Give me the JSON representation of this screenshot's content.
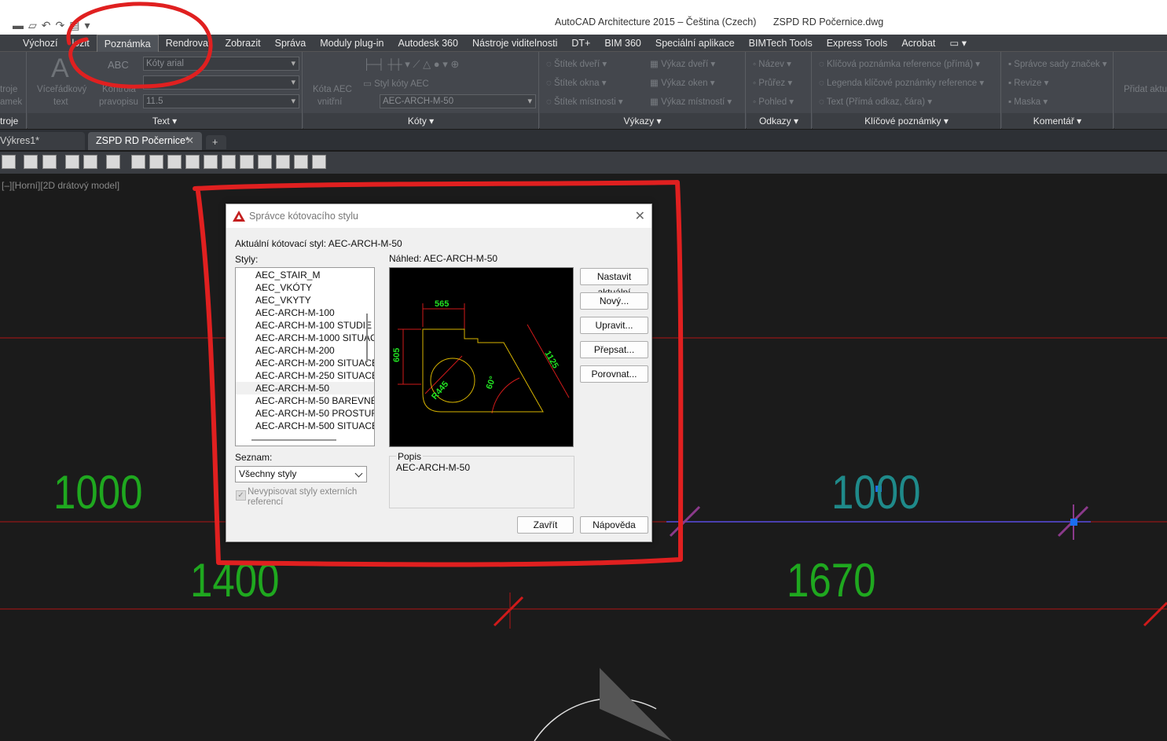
{
  "titlebar": {
    "app_title": "AutoCAD Architecture 2015 – Čeština (Czech)",
    "file_name": "ZSPD RD Počernice.dwg"
  },
  "ribbon_tabs": [
    "Výchozí",
    "ložit",
    "Poznámka",
    "Rendrovat",
    "Zobrazit",
    "Správa",
    "Moduly plug-in",
    "Autodesk 360",
    "Nástroje viditelnosti",
    "DT+",
    "BIM 360",
    "Speciální aplikace",
    "BIMTech Tools",
    "Express Tools",
    "Acrobat"
  ],
  "active_tab": "Poznámka",
  "ribbon": {
    "left_partial_1": "troje",
    "left_partial_2": "amek",
    "left_panel_label": "troje",
    "text_panel": {
      "mtext_label_1": "Víceřádkový",
      "mtext_label_2": "text",
      "spell_label_1": "Kontrola",
      "spell_label_2": "pravopisu",
      "abc": "ABC",
      "style_value": "Kóty arial",
      "height_value": "11.5",
      "label": "Text"
    },
    "dims_panel": {
      "aec_dim_label_1": "Kóta AEC",
      "aec_dim_label_2": "vnitřní",
      "aec_style_label": "Styl kóty AEC",
      "dim_style_value": "AEC-ARCH-M-50",
      "label": "Kóty"
    },
    "reports_panel": {
      "items_left": [
        "Štítek dveří",
        "Štítek okna",
        "Štítek místnosti"
      ],
      "items_right": [
        "Výkaz dveří",
        "Výkaz oken",
        "Výkaz místností"
      ],
      "label": "Výkazy"
    },
    "refs_panel": {
      "items": [
        "Název",
        "Průřez",
        "Pohled"
      ],
      "label": "Odkazy"
    },
    "keynotes_panel": {
      "items": [
        "Klíčová poznámka reference (přímá)",
        "Legenda klíčové poznámky reference",
        "Text (Přímá odkaz, čára)"
      ],
      "label": "Klíčové poznámky"
    },
    "comment_panel": {
      "items": [
        "Správce sady značek",
        "Revize",
        "Maska"
      ],
      "label": "Komentář"
    },
    "right_partial": "Přidat aktu"
  },
  "doc_tabs": [
    {
      "label": "Výkres1*"
    },
    {
      "label": "ZSPD RD Počernice*"
    }
  ],
  "viewport_label": "[–][Horní][2D drátový model]",
  "canvas_dims": [
    "1000",
    "1000",
    "1400",
    "1670"
  ],
  "dialog": {
    "title": "Správce kótovacího stylu",
    "current_style_label": "Aktuální kótovací styl: AEC-ARCH-M-50",
    "styles_label": "Styly:",
    "preview_label": "Náhled: AEC-ARCH-M-50",
    "styles": [
      "AEC_STAIR_M",
      "AEC_VKÓTY",
      "AEC_VKYTY",
      "AEC-ARCH-M-100",
      "AEC-ARCH-M-100 STUDIE",
      "AEC-ARCH-M-1000 SITUAC",
      "AEC-ARCH-M-200",
      "AEC-ARCH-M-200 SITUACE",
      "AEC-ARCH-M-250 SITUACE",
      "AEC-ARCH-M-50",
      "AEC-ARCH-M-50 BAREVNÉ",
      "AEC-ARCH-M-50 PROSTUF",
      "AEC-ARCH-M-500 SITUACE"
    ],
    "selected_style": "AEC-ARCH-M-50",
    "buttons": {
      "set_current": "Nastavit aktuální",
      "new": "Nový...",
      "modify": "Upravit...",
      "override": "Přepsat...",
      "compare": "Porovnat..."
    },
    "list_label": "Seznam:",
    "list_value": "Všechny styly",
    "xref_checkbox_1": "Nevypisovat styly externích",
    "xref_checkbox_2": "referencí",
    "description_label": "Popis",
    "description_value": "AEC-ARCH-M-50",
    "close": "Zavřít",
    "help": "Nápověda",
    "preview_dims": {
      "top": "565",
      "left": "605",
      "diag": "1125",
      "radius": "R445",
      "angle": "60°"
    }
  }
}
